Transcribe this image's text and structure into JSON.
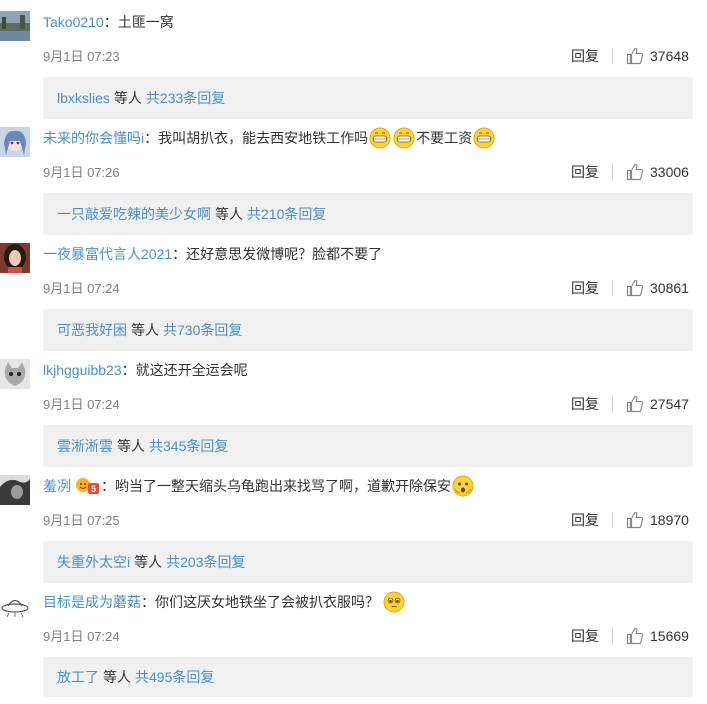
{
  "comments": [
    {
      "username": "Tako0210",
      "text_parts": [
        "土匪一窝"
      ],
      "time": "9月1日 07:23",
      "reply_label": "回复",
      "likes": "37648",
      "sub_user": "lbxkslies",
      "sub_mid": "等人",
      "sub_count": "共233条回复",
      "avatar": "landscape-avatar"
    },
    {
      "username": "未来的你会懂吗i",
      "text_parts": [
        "我叫胡扒衣，能去西安地铁工作吗",
        "不要工资"
      ],
      "emojis": [
        "grin-emoji",
        "grin-emoji",
        "grin-emoji"
      ],
      "time": "9月1日 07:26",
      "reply_label": "回复",
      "likes": "33006",
      "sub_user": "一只敲爱吃辣的美少女啊",
      "sub_mid": "等人",
      "sub_count": "共210条回复",
      "avatar": "anime-girl-avatar"
    },
    {
      "username": "一夜暴富代言人2021",
      "text_parts": [
        "还好意思发微博呢？脸都不要了"
      ],
      "time": "9月1日 07:24",
      "reply_label": "回复",
      "likes": "30861",
      "sub_user": "可恶我好困",
      "sub_mid": "等人",
      "sub_count": "共730条回复",
      "avatar": "woman-avatar"
    },
    {
      "username": "lkjhgguibb23",
      "text_parts": [
        "就这还开全运会呢"
      ],
      "time": "9月1日 07:24",
      "reply_label": "回复",
      "likes": "27547",
      "sub_user": "雲淅淅雲",
      "sub_mid": "等人",
      "sub_count": "共345条回复",
      "avatar": "cat-avatar"
    },
    {
      "username": "羞冽",
      "text_parts": [
        "哟当了一整天缩头乌龟跑出来找骂了啊，道歉开除保安"
      ],
      "time": "9月1日 07:25",
      "reply_label": "回复",
      "likes": "18970",
      "sub_user": "失重外太空i",
      "sub_mid": "等人",
      "sub_count": "共203条回复",
      "avatar": "bw-portrait-avatar",
      "badge": "vip-level-badge"
    },
    {
      "username": "目标是成为蘑菇",
      "text_parts": [
        "你们这厌女地铁坐了会被扒衣服吗？"
      ],
      "time": "9月1日 07:24",
      "reply_label": "回复",
      "likes": "15669",
      "sub_user": "放工了",
      "sub_mid": "等人",
      "sub_count": "共495条回复",
      "avatar": "ufo-sketch-avatar"
    }
  ],
  "colors": {
    "link": "#4a90c8",
    "text": "#333333",
    "meta": "#808080",
    "sub_bg": "#f0f0f0"
  }
}
